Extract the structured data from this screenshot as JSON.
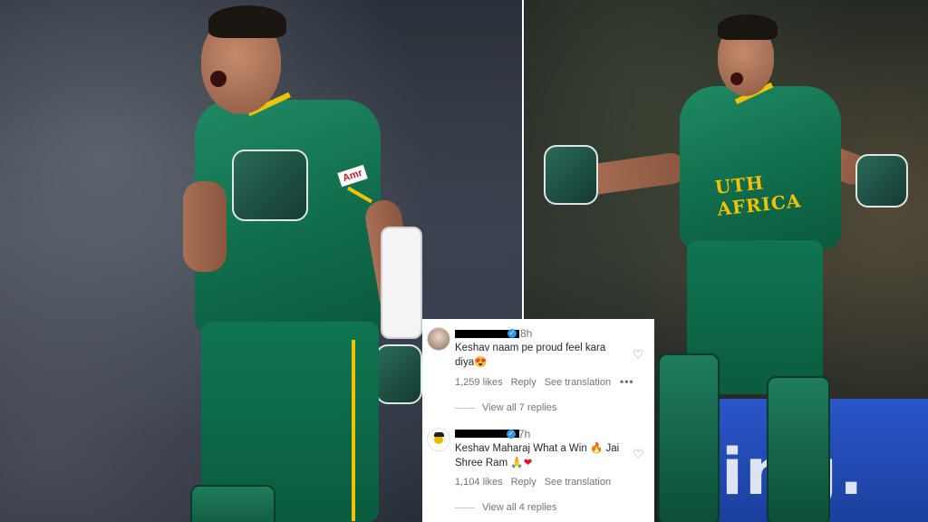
{
  "comments": [
    {
      "time": "8h",
      "text": "Keshav naam pe proud feel kara diya",
      "emoji_end": "😍",
      "likes": "1,259 likes",
      "reply_label": "Reply",
      "translate_label": "See translation",
      "more_label": "•••",
      "view_replies": "View all 7 replies"
    },
    {
      "time": "7h",
      "text_a": "Keshav Maharaj What a Win",
      "emoji_fire": "🔥",
      "text_b": "Jai Shree Ram",
      "emoji_pray": "🙏",
      "emoji_heart": "❤",
      "likes": "1,104 likes",
      "reply_label": "Reply",
      "translate_label": "See translation",
      "view_replies": "View all 4 replies"
    }
  ],
  "photos": {
    "left_sponsor": "Amr",
    "right_chest": "UTH AFRICA",
    "right_banner": "ing."
  },
  "icons": {
    "heart": "heart-outline-icon",
    "verified": "verified-badge-icon"
  },
  "colors": {
    "jersey_green": "#0f6a4a",
    "jersey_yellow": "#f2c200",
    "verified_blue": "#2b95f0",
    "meta_gray": "#737373"
  }
}
